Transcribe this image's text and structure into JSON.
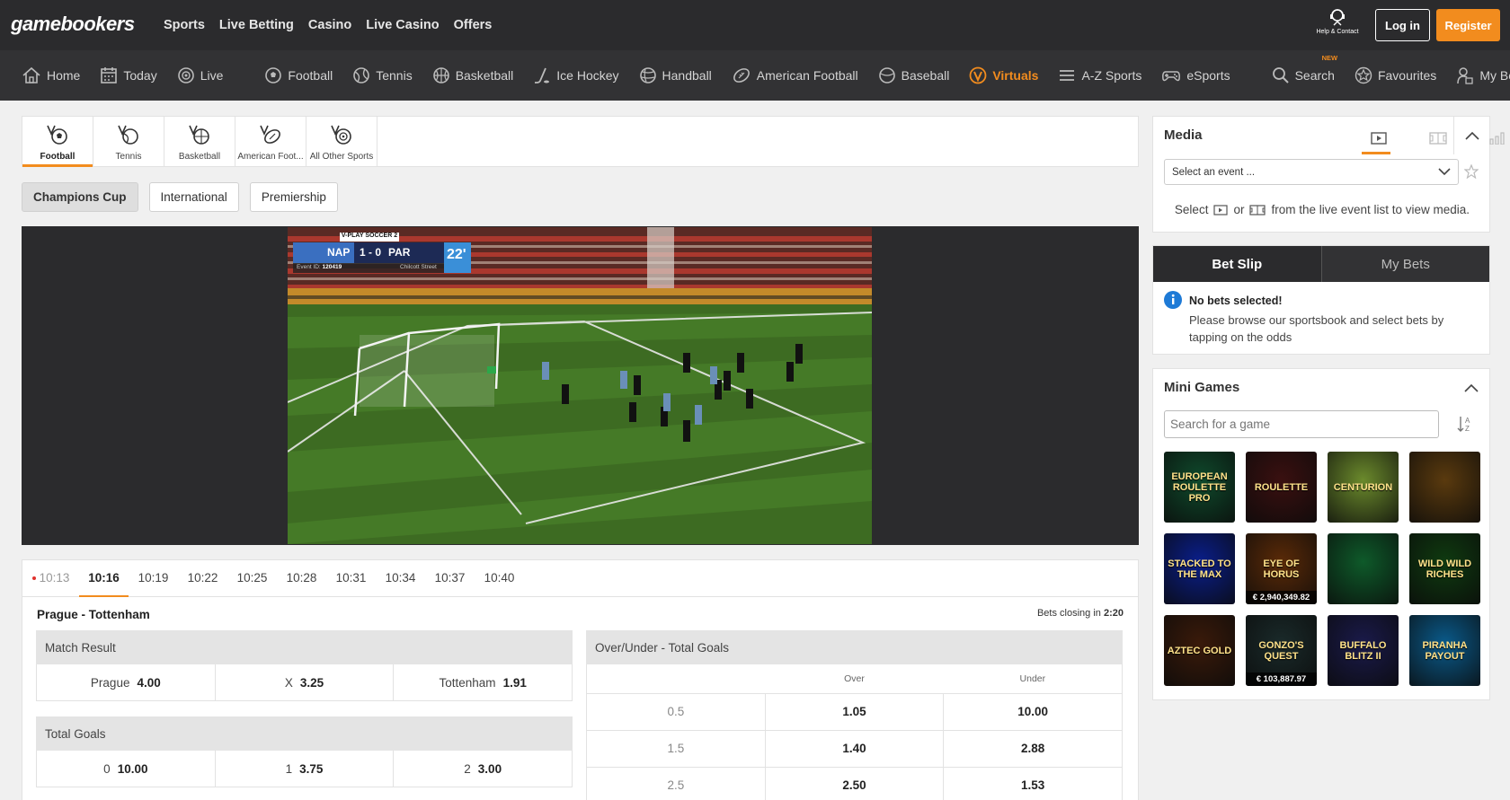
{
  "header": {
    "logo": "gamebookers",
    "nav": [
      "Sports",
      "Live Betting",
      "Casino",
      "Live Casino",
      "Offers"
    ],
    "help_label": "Help & Contact",
    "login": "Log in",
    "register": "Register"
  },
  "sportsnav": {
    "items": [
      {
        "label": "Home",
        "icon": "home-icon"
      },
      {
        "label": "Today",
        "icon": "calendar-icon"
      },
      {
        "label": "Live",
        "icon": "live-icon"
      },
      {
        "label": "Football",
        "icon": "football-icon"
      },
      {
        "label": "Tennis",
        "icon": "tennis-icon"
      },
      {
        "label": "Basketball",
        "icon": "basketball-icon"
      },
      {
        "label": "Ice Hockey",
        "icon": "hockey-icon"
      },
      {
        "label": "Handball",
        "icon": "handball-icon"
      },
      {
        "label": "American Football",
        "icon": "american-football-icon"
      },
      {
        "label": "Baseball",
        "icon": "baseball-icon"
      },
      {
        "label": "Virtuals",
        "icon": "virtuals-icon"
      },
      {
        "label": "A-Z Sports",
        "icon": "menu-icon"
      },
      {
        "label": "eSports",
        "icon": "gamepad-icon"
      },
      {
        "label": "Search",
        "icon": "search-icon"
      },
      {
        "label": "Favourites",
        "icon": "star-icon"
      },
      {
        "label": "My Bets",
        "icon": "mybets-icon"
      }
    ],
    "new_badge": "NEW"
  },
  "virtual_tabs": [
    {
      "label": "Football"
    },
    {
      "label": "Tennis"
    },
    {
      "label": "Basketball"
    },
    {
      "label": "American Foot..."
    },
    {
      "label": "All Other Sports"
    }
  ],
  "leagues": [
    "Champions Cup",
    "International",
    "Premiership"
  ],
  "video": {
    "title": "V-PLAY SOCCER 2",
    "home": "NAP",
    "score": "1 - 0",
    "away": "PAR",
    "minute": "22'",
    "event_id_label": "Event ID:",
    "event_id": "120419",
    "venue": "Chilcott Street"
  },
  "times": [
    "10:13",
    "10:16",
    "10:19",
    "10:22",
    "10:25",
    "10:28",
    "10:31",
    "10:34",
    "10:37",
    "10:40"
  ],
  "match": {
    "title": "Prague - Tottenham",
    "closing_label": "Bets closing in",
    "closing_time": "2:20"
  },
  "match_result": {
    "title": "Match Result",
    "options": [
      {
        "label": "Prague",
        "odds": "4.00"
      },
      {
        "label": "X",
        "odds": "3.25"
      },
      {
        "label": "Tottenham",
        "odds": "1.91"
      }
    ]
  },
  "total_goals": {
    "title": "Total Goals",
    "options": [
      {
        "label": "0",
        "odds": "10.00"
      },
      {
        "label": "1",
        "odds": "3.75"
      },
      {
        "label": "2",
        "odds": "3.00"
      }
    ]
  },
  "over_under": {
    "title": "Over/Under - Total Goals",
    "over_label": "Over",
    "under_label": "Under",
    "rows": [
      {
        "line": "0.5",
        "over": "1.05",
        "under": "10.00"
      },
      {
        "line": "1.5",
        "over": "1.40",
        "under": "2.88"
      },
      {
        "line": "2.5",
        "over": "2.50",
        "under": "1.53"
      }
    ]
  },
  "media": {
    "title": "Media",
    "select_placeholder": "Select an event ...",
    "hint_select": "Select",
    "hint_or": "or",
    "hint_rest": "from the live event list to view media."
  },
  "betslip": {
    "tab_slip": "Bet Slip",
    "tab_mybets": "My Bets",
    "no_bets_title": "No bets selected!",
    "no_bets_text": "Please browse our sportsbook and select bets by tapping on the odds"
  },
  "minigames": {
    "title": "Mini Games",
    "search_placeholder": "Search for a game",
    "games": [
      {
        "name": "EUROPEAN ROULETTE PRO",
        "color": "#0f4a2c"
      },
      {
        "name": "ROULETTE",
        "color": "#3a1010"
      },
      {
        "name": "CENTURION",
        "color": "#6b8a2c"
      },
      {
        "name": "",
        "color": "#5a3a0e"
      },
      {
        "name": "STACKED TO THE MAX",
        "color": "#0a1e8a"
      },
      {
        "name": "EYE OF HORUS",
        "color": "#5a2a08",
        "jackpot": "€ 2,940,349.82"
      },
      {
        "name": "",
        "color": "#0e5a2a"
      },
      {
        "name": "WILD WILD RICHES",
        "color": "#0f3a10"
      },
      {
        "name": "AZTEC GOLD",
        "color": "#3a1a0a"
      },
      {
        "name": "GONZO'S QUEST",
        "color": "#1a2a2a",
        "jackpot": "€ 103,887.97"
      },
      {
        "name": "BUFFALO BLITZ II",
        "color": "#1a1a4a"
      },
      {
        "name": "PIRANHA PAYOUT",
        "color": "#0a5a8a"
      }
    ]
  },
  "colors": {
    "accent": "#f28c1e",
    "header_bg": "#2b2b2d",
    "nav_bg": "#323234"
  }
}
